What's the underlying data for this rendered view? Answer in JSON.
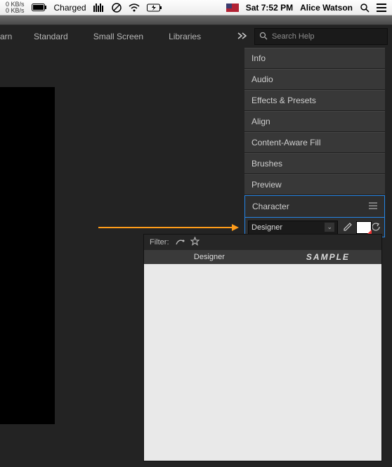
{
  "menubar": {
    "net_up": "0 KB/s",
    "net_down": "0 KB/s",
    "battery_label": "Charged",
    "datetime": "Sat 7:52 PM",
    "user": "Alice Watson"
  },
  "tabs": {
    "cut": "arn",
    "standard": "Standard",
    "small": "Small Screen",
    "libraries": "Libraries"
  },
  "search": {
    "placeholder": "Search Help"
  },
  "panels": {
    "info": "Info",
    "audio": "Audio",
    "fx": "Effects & Presets",
    "align": "Align",
    "caf": "Content-Aware Fill",
    "brushes": "Brushes",
    "preview": "Preview",
    "character": "Character"
  },
  "char": {
    "font": "Designer"
  },
  "fontpop": {
    "filter_label": "Filter:",
    "col_name": "Designer",
    "col_sample": "SAMPLE"
  }
}
